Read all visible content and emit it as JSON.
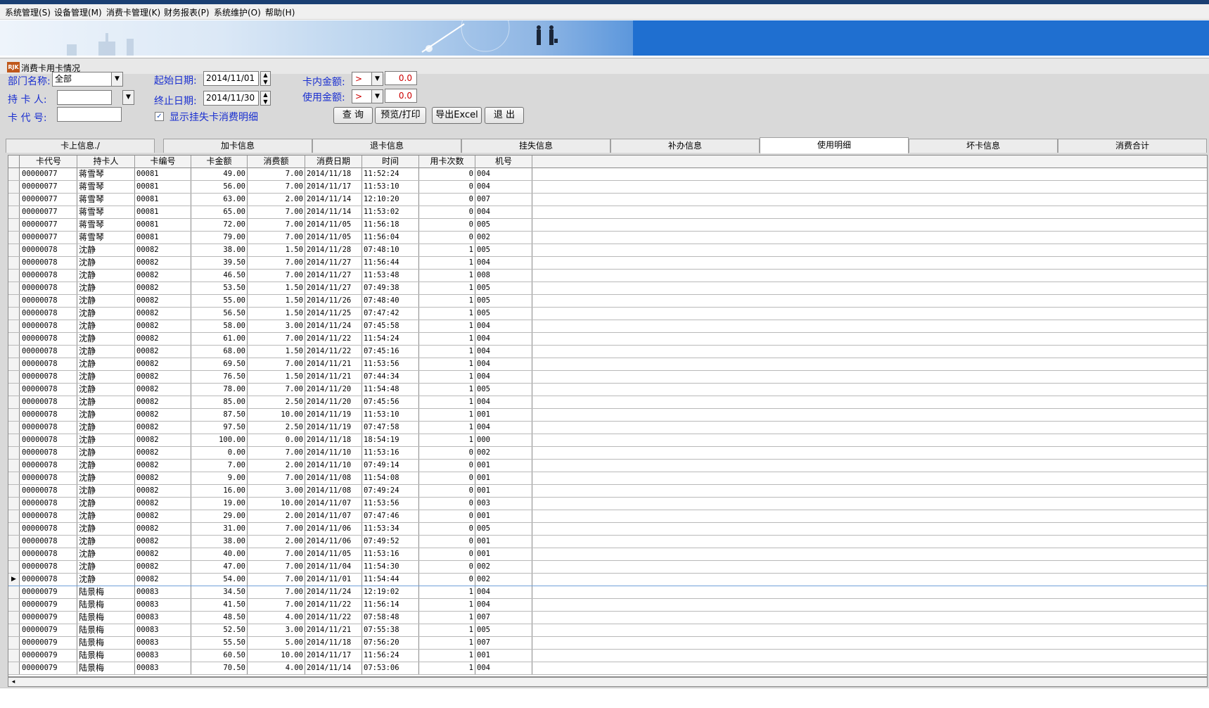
{
  "menu": [
    {
      "label": "系统管理(S)"
    },
    {
      "label": "设备管理(M)"
    },
    {
      "label": "消费卡管理(K)"
    },
    {
      "label": "财务报表(P)"
    },
    {
      "label": "系统维护(O)"
    },
    {
      "label": "帮助(H)"
    }
  ],
  "window": {
    "title": "消费卡用卡情况",
    "logo": "RJK"
  },
  "filters": {
    "dept_label": "部门名称:",
    "dept_value": "全部",
    "holder_label": "持 卡 人:",
    "holder_value": "",
    "card_label": "卡 代 号:",
    "card_value": "",
    "start_label": "起始日期:",
    "start_value": "2014/11/01",
    "end_label": "终止日期:",
    "end_value": "2014/11/30",
    "show_lost_label": "显示挂失卡消费明细",
    "show_lost_checked": "✓",
    "balance_label": "卡内金额:",
    "balance_op": ">",
    "balance_value": "0.0",
    "used_label": "使用金额:",
    "used_op": ">",
    "used_value": "0.0"
  },
  "buttons": {
    "query": "查 询",
    "preview": "预览/打印",
    "export": "导出Excel",
    "exit": "退 出"
  },
  "tabs": [
    {
      "label": "卡上信息./"
    },
    {
      "label": "加卡信息"
    },
    {
      "label": "退卡信息"
    },
    {
      "label": "挂失信息"
    },
    {
      "label": "补办信息"
    },
    {
      "label": "使用明细"
    },
    {
      "label": "坏卡信息"
    },
    {
      "label": "消费合计"
    }
  ],
  "active_tab": "使用明细",
  "columns": [
    "卡代号",
    "持卡人",
    "卡编号",
    "卡金额",
    "消费额",
    "消费日期",
    "时间",
    "用卡次数",
    "机号"
  ],
  "current_row_index": 32,
  "rows": [
    [
      "00000077",
      "蒋雪琴",
      "00081",
      "49.00",
      "7.00",
      "2014/11/18",
      "11:52:24",
      "0",
      "004"
    ],
    [
      "00000077",
      "蒋雪琴",
      "00081",
      "56.00",
      "7.00",
      "2014/11/17",
      "11:53:10",
      "0",
      "004"
    ],
    [
      "00000077",
      "蒋雪琴",
      "00081",
      "63.00",
      "2.00",
      "2014/11/14",
      "12:10:20",
      "0",
      "007"
    ],
    [
      "00000077",
      "蒋雪琴",
      "00081",
      "65.00",
      "7.00",
      "2014/11/14",
      "11:53:02",
      "0",
      "004"
    ],
    [
      "00000077",
      "蒋雪琴",
      "00081",
      "72.00",
      "7.00",
      "2014/11/05",
      "11:56:18",
      "0",
      "005"
    ],
    [
      "00000077",
      "蒋雪琴",
      "00081",
      "79.00",
      "7.00",
      "2014/11/05",
      "11:56:04",
      "0",
      "002"
    ],
    [
      "00000078",
      "沈静",
      "00082",
      "38.00",
      "1.50",
      "2014/11/28",
      "07:48:10",
      "1",
      "005"
    ],
    [
      "00000078",
      "沈静",
      "00082",
      "39.50",
      "7.00",
      "2014/11/27",
      "11:56:44",
      "1",
      "004"
    ],
    [
      "00000078",
      "沈静",
      "00082",
      "46.50",
      "7.00",
      "2014/11/27",
      "11:53:48",
      "1",
      "008"
    ],
    [
      "00000078",
      "沈静",
      "00082",
      "53.50",
      "1.50",
      "2014/11/27",
      "07:49:38",
      "1",
      "005"
    ],
    [
      "00000078",
      "沈静",
      "00082",
      "55.00",
      "1.50",
      "2014/11/26",
      "07:48:40",
      "1",
      "005"
    ],
    [
      "00000078",
      "沈静",
      "00082",
      "56.50",
      "1.50",
      "2014/11/25",
      "07:47:42",
      "1",
      "005"
    ],
    [
      "00000078",
      "沈静",
      "00082",
      "58.00",
      "3.00",
      "2014/11/24",
      "07:45:58",
      "1",
      "004"
    ],
    [
      "00000078",
      "沈静",
      "00082",
      "61.00",
      "7.00",
      "2014/11/22",
      "11:54:24",
      "1",
      "004"
    ],
    [
      "00000078",
      "沈静",
      "00082",
      "68.00",
      "1.50",
      "2014/11/22",
      "07:45:16",
      "1",
      "004"
    ],
    [
      "00000078",
      "沈静",
      "00082",
      "69.50",
      "7.00",
      "2014/11/21",
      "11:53:56",
      "1",
      "004"
    ],
    [
      "00000078",
      "沈静",
      "00082",
      "76.50",
      "1.50",
      "2014/11/21",
      "07:44:34",
      "1",
      "004"
    ],
    [
      "00000078",
      "沈静",
      "00082",
      "78.00",
      "7.00",
      "2014/11/20",
      "11:54:48",
      "1",
      "005"
    ],
    [
      "00000078",
      "沈静",
      "00082",
      "85.00",
      "2.50",
      "2014/11/20",
      "07:45:56",
      "1",
      "004"
    ],
    [
      "00000078",
      "沈静",
      "00082",
      "87.50",
      "10.00",
      "2014/11/19",
      "11:53:10",
      "1",
      "001"
    ],
    [
      "00000078",
      "沈静",
      "00082",
      "97.50",
      "2.50",
      "2014/11/19",
      "07:47:58",
      "1",
      "004"
    ],
    [
      "00000078",
      "沈静",
      "00082",
      "100.00",
      "0.00",
      "2014/11/18",
      "18:54:19",
      "1",
      "000"
    ],
    [
      "00000078",
      "沈静",
      "00082",
      "0.00",
      "7.00",
      "2014/11/10",
      "11:53:16",
      "0",
      "002"
    ],
    [
      "00000078",
      "沈静",
      "00082",
      "7.00",
      "2.00",
      "2014/11/10",
      "07:49:14",
      "0",
      "001"
    ],
    [
      "00000078",
      "沈静",
      "00082",
      "9.00",
      "7.00",
      "2014/11/08",
      "11:54:08",
      "0",
      "001"
    ],
    [
      "00000078",
      "沈静",
      "00082",
      "16.00",
      "3.00",
      "2014/11/08",
      "07:49:24",
      "0",
      "001"
    ],
    [
      "00000078",
      "沈静",
      "00082",
      "19.00",
      "10.00",
      "2014/11/07",
      "11:53:56",
      "0",
      "003"
    ],
    [
      "00000078",
      "沈静",
      "00082",
      "29.00",
      "2.00",
      "2014/11/07",
      "07:47:46",
      "0",
      "001"
    ],
    [
      "00000078",
      "沈静",
      "00082",
      "31.00",
      "7.00",
      "2014/11/06",
      "11:53:34",
      "0",
      "005"
    ],
    [
      "00000078",
      "沈静",
      "00082",
      "38.00",
      "2.00",
      "2014/11/06",
      "07:49:52",
      "0",
      "001"
    ],
    [
      "00000078",
      "沈静",
      "00082",
      "40.00",
      "7.00",
      "2014/11/05",
      "11:53:16",
      "0",
      "001"
    ],
    [
      "00000078",
      "沈静",
      "00082",
      "47.00",
      "7.00",
      "2014/11/04",
      "11:54:30",
      "0",
      "002"
    ],
    [
      "00000078",
      "沈静",
      "00082",
      "54.00",
      "7.00",
      "2014/11/01",
      "11:54:44",
      "0",
      "002"
    ],
    [
      "00000079",
      "陆景梅",
      "00083",
      "34.50",
      "7.00",
      "2014/11/24",
      "12:19:02",
      "1",
      "004"
    ],
    [
      "00000079",
      "陆景梅",
      "00083",
      "41.50",
      "7.00",
      "2014/11/22",
      "11:56:14",
      "1",
      "004"
    ],
    [
      "00000079",
      "陆景梅",
      "00083",
      "48.50",
      "4.00",
      "2014/11/22",
      "07:58:48",
      "1",
      "007"
    ],
    [
      "00000079",
      "陆景梅",
      "00083",
      "52.50",
      "3.00",
      "2014/11/21",
      "07:55:38",
      "1",
      "005"
    ],
    [
      "00000079",
      "陆景梅",
      "00083",
      "55.50",
      "5.00",
      "2014/11/18",
      "07:56:20",
      "1",
      "007"
    ],
    [
      "00000079",
      "陆景梅",
      "00083",
      "60.50",
      "10.00",
      "2014/11/17",
      "11:56:24",
      "1",
      "001"
    ],
    [
      "00000079",
      "陆景梅",
      "00083",
      "70.50",
      "4.00",
      "2014/11/14",
      "07:53:06",
      "1",
      "004"
    ]
  ]
}
